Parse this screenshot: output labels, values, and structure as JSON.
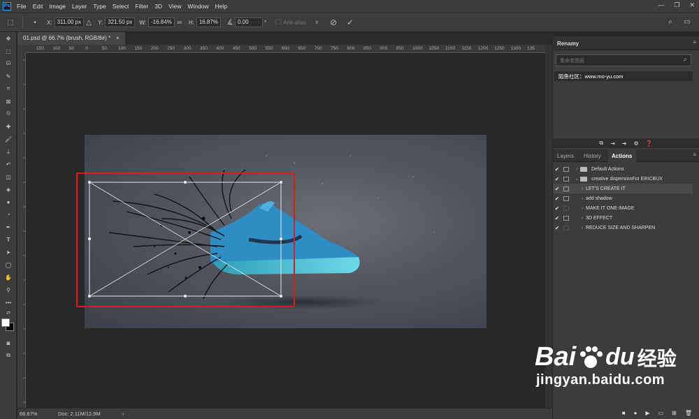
{
  "app": {
    "logo": "Ps"
  },
  "menu": [
    "File",
    "Edit",
    "Image",
    "Layer",
    "Type",
    "Select",
    "Filter",
    "3D",
    "View",
    "Window",
    "Help"
  ],
  "options": {
    "x_label": "X:",
    "x_value": "311.00 px",
    "y_label": "Y:",
    "y_value": "321.50 px",
    "w_label": "W:",
    "w_value": "-16.84%",
    "h_label": "H:",
    "h_value": "16.87%",
    "angle_value": "0.00",
    "angle_unit": "°",
    "antialias": "Anti-alias",
    "cancel_icon": "cancel-transform-icon",
    "commit_icon": "commit-transform-icon"
  },
  "document": {
    "tab_title": "01.psd @ 66.7% (brush, RGB/8#) *",
    "close": "×"
  },
  "ruler_ticks": [
    "150",
    "100",
    "50",
    "0",
    "50",
    "100",
    "150",
    "200",
    "250",
    "300",
    "350",
    "400",
    "450",
    "500",
    "550",
    "600",
    "650",
    "700",
    "750",
    "800",
    "850",
    "900",
    "950",
    "1000",
    "1050",
    "1100",
    "1150",
    "1200",
    "1250",
    "1300",
    "135"
  ],
  "status": {
    "zoom": "66.67%",
    "doc": "Doc: 2.11M/12.9M",
    "arrow": "›"
  },
  "renamy": {
    "title": "Renamy",
    "search_placeholder": "重命名图层",
    "item": "陌鱼社区：www.mo-yu.com"
  },
  "tabs": {
    "layers": "Layers",
    "history": "History",
    "actions": "Actions"
  },
  "actions": [
    {
      "label": "Default Actions",
      "checked": true,
      "folder": true,
      "expanded": false
    },
    {
      "label": "creative dispersionFor ERICBUX",
      "checked": true,
      "folder": true,
      "expanded": true
    },
    {
      "label": "LET'S CREATE IT",
      "checked": true,
      "folder": false,
      "selected": true
    },
    {
      "label": "add shadow",
      "checked": true,
      "folder": false
    },
    {
      "label": "MAKE IT ONE IMAGE",
      "checked": true,
      "folder": false
    },
    {
      "label": "3D EFFECT",
      "checked": true,
      "folder": false
    },
    {
      "label": "REDUCE SIZE AND SHARPEN",
      "checked": true,
      "folder": false
    }
  ],
  "watermark": {
    "brand": "Bai",
    "brand2": "du",
    "cn": "经验",
    "url": "jingyan.baidu.com"
  }
}
